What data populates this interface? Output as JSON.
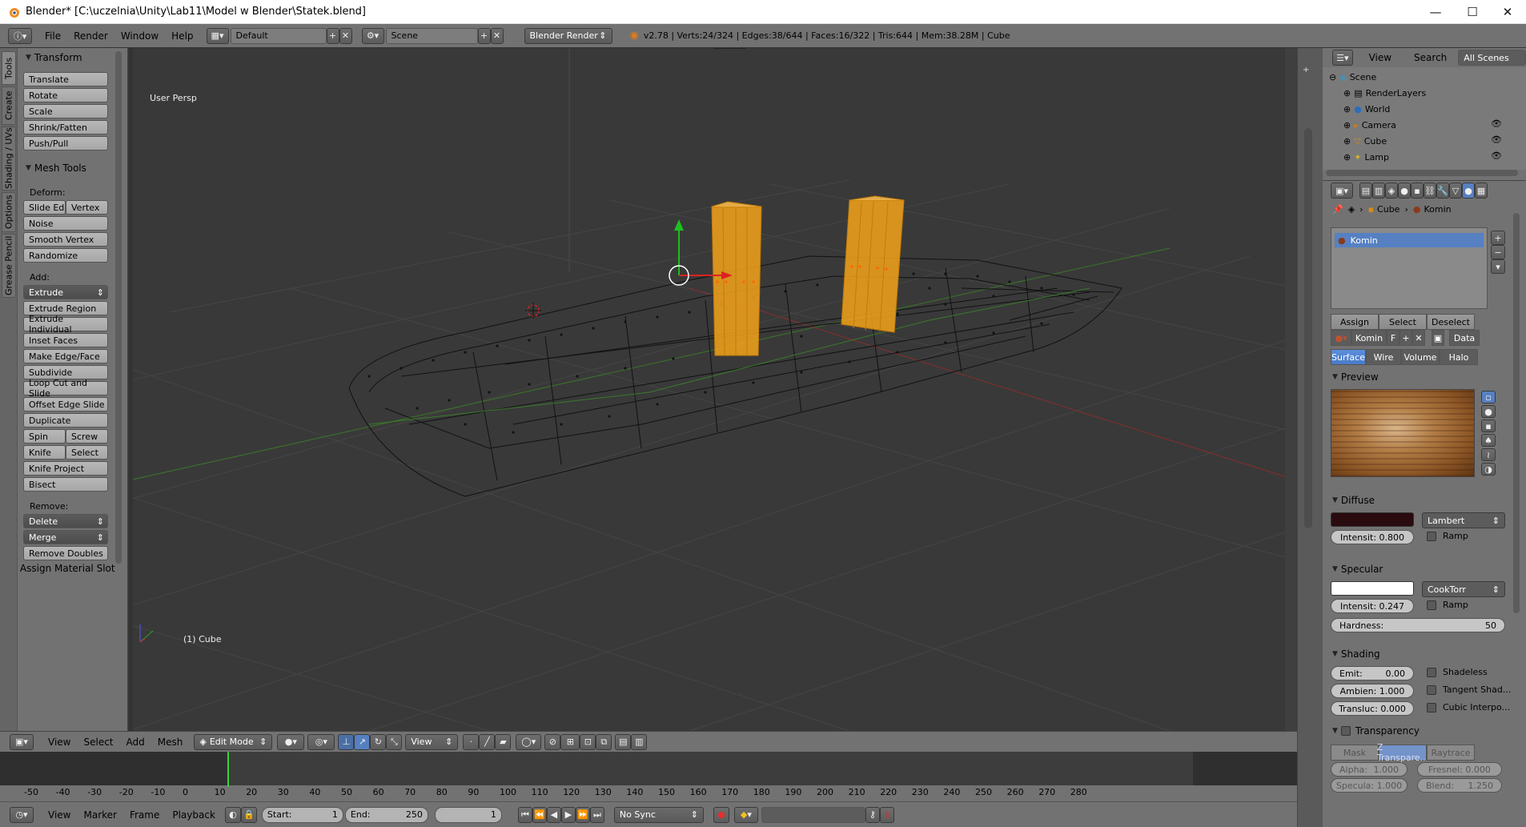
{
  "titlebar": {
    "title": "Blender* [C:\\uczelnia\\Unity\\Lab11\\Model w Blender\\Statek.blend]",
    "minimize": "—",
    "maximize": "☐",
    "close": "✕"
  },
  "infobar": {
    "menus": [
      "File",
      "Render",
      "Window",
      "Help"
    ],
    "layout": "Default",
    "scene": "Scene",
    "engine": "Blender Render",
    "stats": "v2.78 | Verts:24/324 | Edges:38/644 | Faces:16/322 | Tris:644 | Mem:38.28M | Cube"
  },
  "tool_tabs": [
    "Tools",
    "Create",
    "Shading / UVs",
    "Options",
    "Grease Pencil"
  ],
  "toolshelf": {
    "transform_title": "Transform",
    "transform": [
      "Translate",
      "Rotate",
      "Scale",
      "Shrink/Fatten",
      "Push/Pull"
    ],
    "mesh_tools_title": "Mesh Tools",
    "deform_label": "Deform:",
    "slide_edge": "Slide Ed",
    "vertex": "Vertex",
    "noise": "Noise",
    "smooth_vertex": "Smooth Vertex",
    "randomize": "Randomize",
    "add_label": "Add:",
    "extrude": "Extrude",
    "add_items": [
      "Extrude Region",
      "Extrude Individual",
      "Inset Faces",
      "Make Edge/Face",
      "Subdivide",
      "Loop Cut and Slide",
      "Offset Edge Slide",
      "Duplicate"
    ],
    "spin": "Spin",
    "screw": "Screw",
    "knife": "Knife",
    "select": "Select",
    "knife_project": "Knife Project",
    "bisect": "Bisect",
    "remove_label": "Remove:",
    "delete": "Delete",
    "merge": "Merge",
    "remove_doubles": "Remove Doubles",
    "assign_slot": "Assign Material Slot"
  },
  "viewport": {
    "view_name": "User Persp",
    "object_label": "(1) Cube"
  },
  "vp_header": {
    "view": "View",
    "select": "Select",
    "add": "Add",
    "mesh": "Mesh",
    "mode": "Edit Mode",
    "orientation": "View"
  },
  "timeline": {
    "view": "View",
    "marker": "Marker",
    "frame": "Frame",
    "playback": "Playback",
    "start_label": "Start:",
    "start": "1",
    "end_label": "End:",
    "end": "250",
    "current": "1",
    "sync": "No Sync",
    "ticks": [
      "-50",
      "-40",
      "-30",
      "-20",
      "-10",
      "0",
      "10",
      "20",
      "30",
      "40",
      "50",
      "60",
      "70",
      "80",
      "90",
      "100",
      "110",
      "120",
      "130",
      "140",
      "150",
      "160",
      "170",
      "180",
      "190",
      "200",
      "210",
      "220",
      "230",
      "240",
      "250",
      "260",
      "270",
      "280"
    ]
  },
  "outliner": {
    "view": "View",
    "search": "Search",
    "filter": "All Scenes",
    "items": [
      "Scene",
      "RenderLayers",
      "World",
      "Camera",
      "Cube",
      "Lamp"
    ]
  },
  "props": {
    "breadcrumb_obj": "Cube",
    "breadcrumb_mat": "Komin",
    "slot": "Komin",
    "assign": "Assign",
    "select": "Select",
    "deselect": "Deselect",
    "material_name": "Komin",
    "fake": "F",
    "data": "Data",
    "tabs": [
      "Surface",
      "Wire",
      "Volume",
      "Halo"
    ],
    "preview": "Preview",
    "diffuse": "Diffuse",
    "diffuse_shader": "Lambert",
    "diffuse_intensity": "Intensit: 0.800",
    "ramp": "Ramp",
    "specular": "Specular",
    "spec_shader": "CookTorr",
    "spec_intensity": "Intensit: 0.247",
    "hardness_label": "Hardness:",
    "hardness": "50",
    "shading": "Shading",
    "emit": "Emit:",
    "emit_val": "0.00",
    "ambient": "Ambien: 1.000",
    "transluc": "Transluc: 0.000",
    "shadeless": "Shadeless",
    "tangent": "Tangent Shad...",
    "cubic": "Cubic Interpo...",
    "transparency": "Transparency",
    "mask": "Mask",
    "ztrans": "Z Transpare...",
    "raytrace": "Raytrace",
    "alpha": "Alpha:",
    "alpha_val": "1.000",
    "fresnel": "Fresnel: 0.000",
    "specula": "Specula: 1.000",
    "blend": "Blend:",
    "blend_val": "1.250"
  },
  "colors": {
    "selected": "#f5a31a",
    "diffuse_color": "#2a0b0f",
    "highlight": "#5680c2"
  }
}
